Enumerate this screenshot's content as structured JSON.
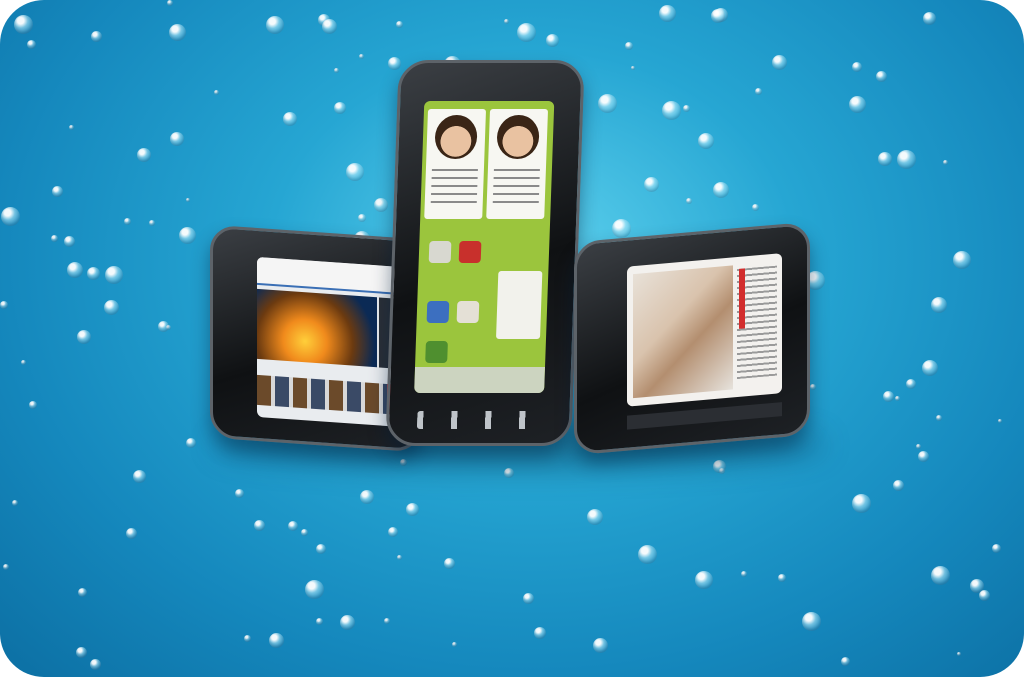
{
  "image": {
    "subject": "three-smartphones",
    "background_color": "#1e9bcf",
    "accent_color": "#9bc53d"
  }
}
